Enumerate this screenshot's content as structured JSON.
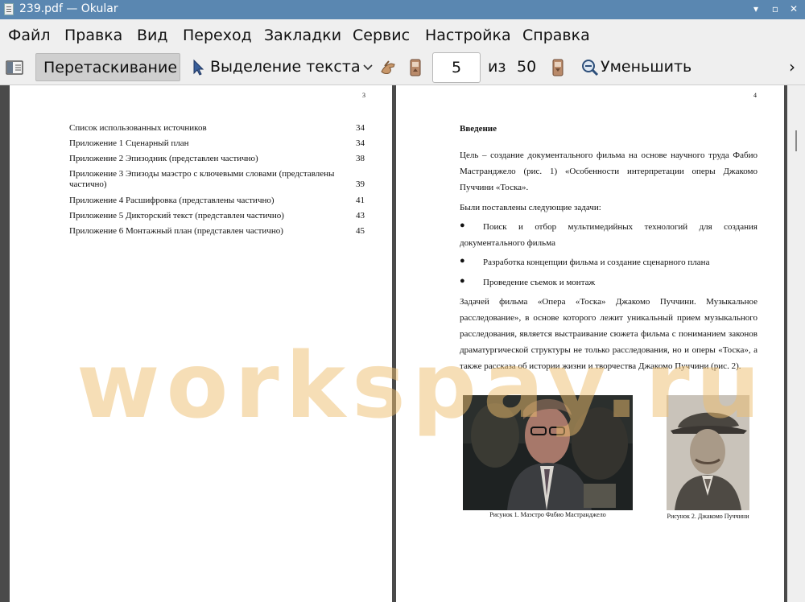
{
  "window": {
    "title": "239.pdf  — Okular",
    "buttons": {
      "minimize": "▾",
      "maximize": "▫",
      "close": "✕"
    }
  },
  "menu": [
    "Файл",
    "Правка",
    "Вид",
    "Переход",
    "Закладки",
    "Сервис",
    "Настройка",
    "Справка"
  ],
  "toolbar": {
    "drag_label": "Перетаскивание",
    "select_label": "Выделение текста",
    "page_value": "5",
    "of_label": "из",
    "total_pages": "50",
    "zoom_out_label": "Уменьшить",
    "more_icon": "›"
  },
  "left_page": {
    "page_number": "3",
    "toc": [
      {
        "title": "Список использованных источников",
        "page": "34"
      },
      {
        "title": "Приложение 1 Сценарный план",
        "page": "34"
      },
      {
        "title": "Приложение 2 Эпизодник (представлен частично)",
        "page": "38"
      },
      {
        "title": "Приложение 3 Эпизоды маэстро с ключевыми словами (представлены частично)",
        "page": "39"
      },
      {
        "title": "Приложение 4 Расшифровка (представлены частично)",
        "page": "41"
      },
      {
        "title": "Приложение 5 Дикторский текст (представлен частично)",
        "page": "43"
      },
      {
        "title": "Приложение 6 Монтажный план (представлен частично)",
        "page": "45"
      }
    ]
  },
  "right_page": {
    "page_number": "4",
    "heading": "Введение",
    "para1": "Цель – создание документального фильма на основе научного труда Фабио Мастранджело (рис. 1) «Особенности интерпретации оперы Джакомо Пуччини «Тоска».",
    "tasks_intro": "Были поставлены следующие задачи:",
    "bullets": [
      "Поиск и отбор мультимедийных технологий для создания документального фильма",
      "Разработка концепции фильма и создание сценарного плана",
      "Проведение съемок и монтаж"
    ],
    "para2": "Задачей фильма «Опера «Тоска» Джакомо Пуччини. Музыкальное расследование», в основе которого лежит уникальный прием музыкального расследования, является выстраивание сюжета фильма с пониманием законов драматургической структуры не только расследования, но и оперы «Тоска», а также рассказа об истории жизни и творчества Джакомо Пуччини (рис. 2).",
    "figure1_caption": "Рисунок 1. Маэстро Фабио Мастранджело",
    "figure2_caption": "Рисунок 2. Джакомо Пуччини"
  },
  "watermark": "workspay.ru",
  "icons": {
    "sidebar": "sidebar-toggle-icon",
    "cursor": "cursor-icon",
    "dropdown": "chevron-down-icon",
    "hand": "hand-icon",
    "prev": "previous-page-icon",
    "next": "next-page-icon",
    "zoom_out": "zoom-out-icon"
  }
}
